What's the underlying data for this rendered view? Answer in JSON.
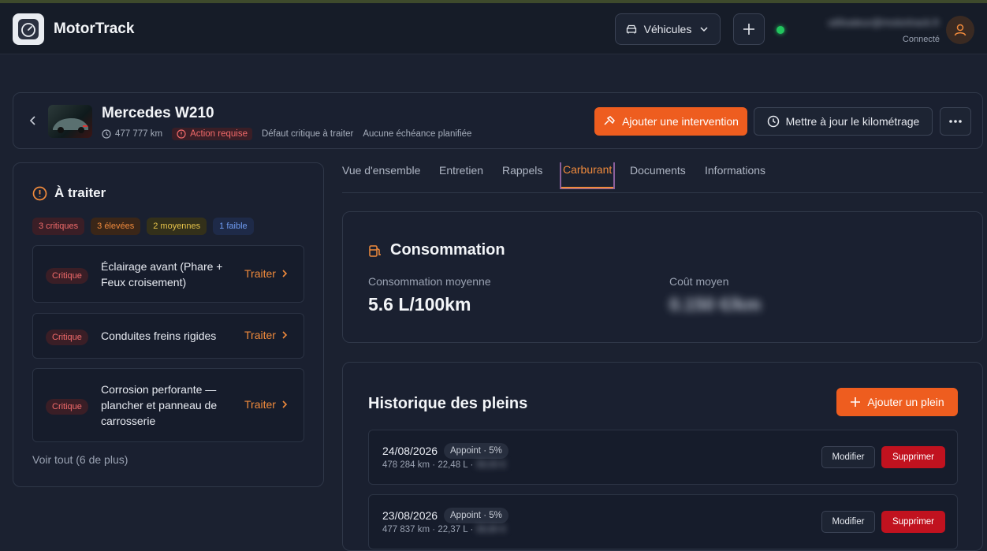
{
  "app": {
    "name": "MotorTrack"
  },
  "header": {
    "vehicles_label": "Véhicules",
    "user_email": "utilisateur@motortrack.fr",
    "user_status": "Connecté"
  },
  "vehicle": {
    "name": "Mercedes W210",
    "km": "477 777 km",
    "status": "Action requise",
    "note1": "Défaut critique à traiter",
    "note2": "Aucune échéance planifiée",
    "add_intervention": "Ajouter une intervention",
    "update_km": "Mettre à jour le kilométrage"
  },
  "todo": {
    "title": "À traiter",
    "chips": [
      "3 critiques",
      "3 élevées",
      "2 moyennes",
      "1 faible"
    ],
    "items": [
      {
        "badge": "Critique",
        "label": "Éclairage avant (Phare + Feux croisement)",
        "action": "Traiter"
      },
      {
        "badge": "Critique",
        "label": "Conduites freins rigides",
        "action": "Traiter"
      },
      {
        "badge": "Critique",
        "label": "Corrosion perforante — plancher et panneau de carrosserie",
        "action": "Traiter"
      }
    ],
    "see_all": "Voir tout (6 de plus)"
  },
  "tabs": [
    "Vue d'ensemble",
    "Entretien",
    "Rappels",
    "Carburant",
    "Documents",
    "Informations"
  ],
  "active_tab": "Carburant",
  "consumption": {
    "title": "Consommation",
    "avg_label": "Consommation moyenne",
    "avg_value": "5.6 L/100km",
    "cost_label": "Coût moyen",
    "cost_value": "0.150 €/km"
  },
  "history": {
    "title": "Historique des pleins",
    "add_label": "Ajouter un plein",
    "rows": [
      {
        "date": "24/08/2026",
        "pill": "Appoint · 5%",
        "meta": "478 284 km · 22,48 L ·",
        "price": "39,00 €",
        "edit": "Modifier",
        "delete": "Supprimer"
      },
      {
        "date": "23/08/2026",
        "pill": "Appoint · 5%",
        "meta": "477 837 km · 22,37 L ·",
        "price": "38,80 €",
        "edit": "Modifier",
        "delete": "Supprimer"
      }
    ]
  },
  "colors": {
    "accent": "#ee5d1f",
    "danger": "#c1121f",
    "online": "#22c55e"
  }
}
